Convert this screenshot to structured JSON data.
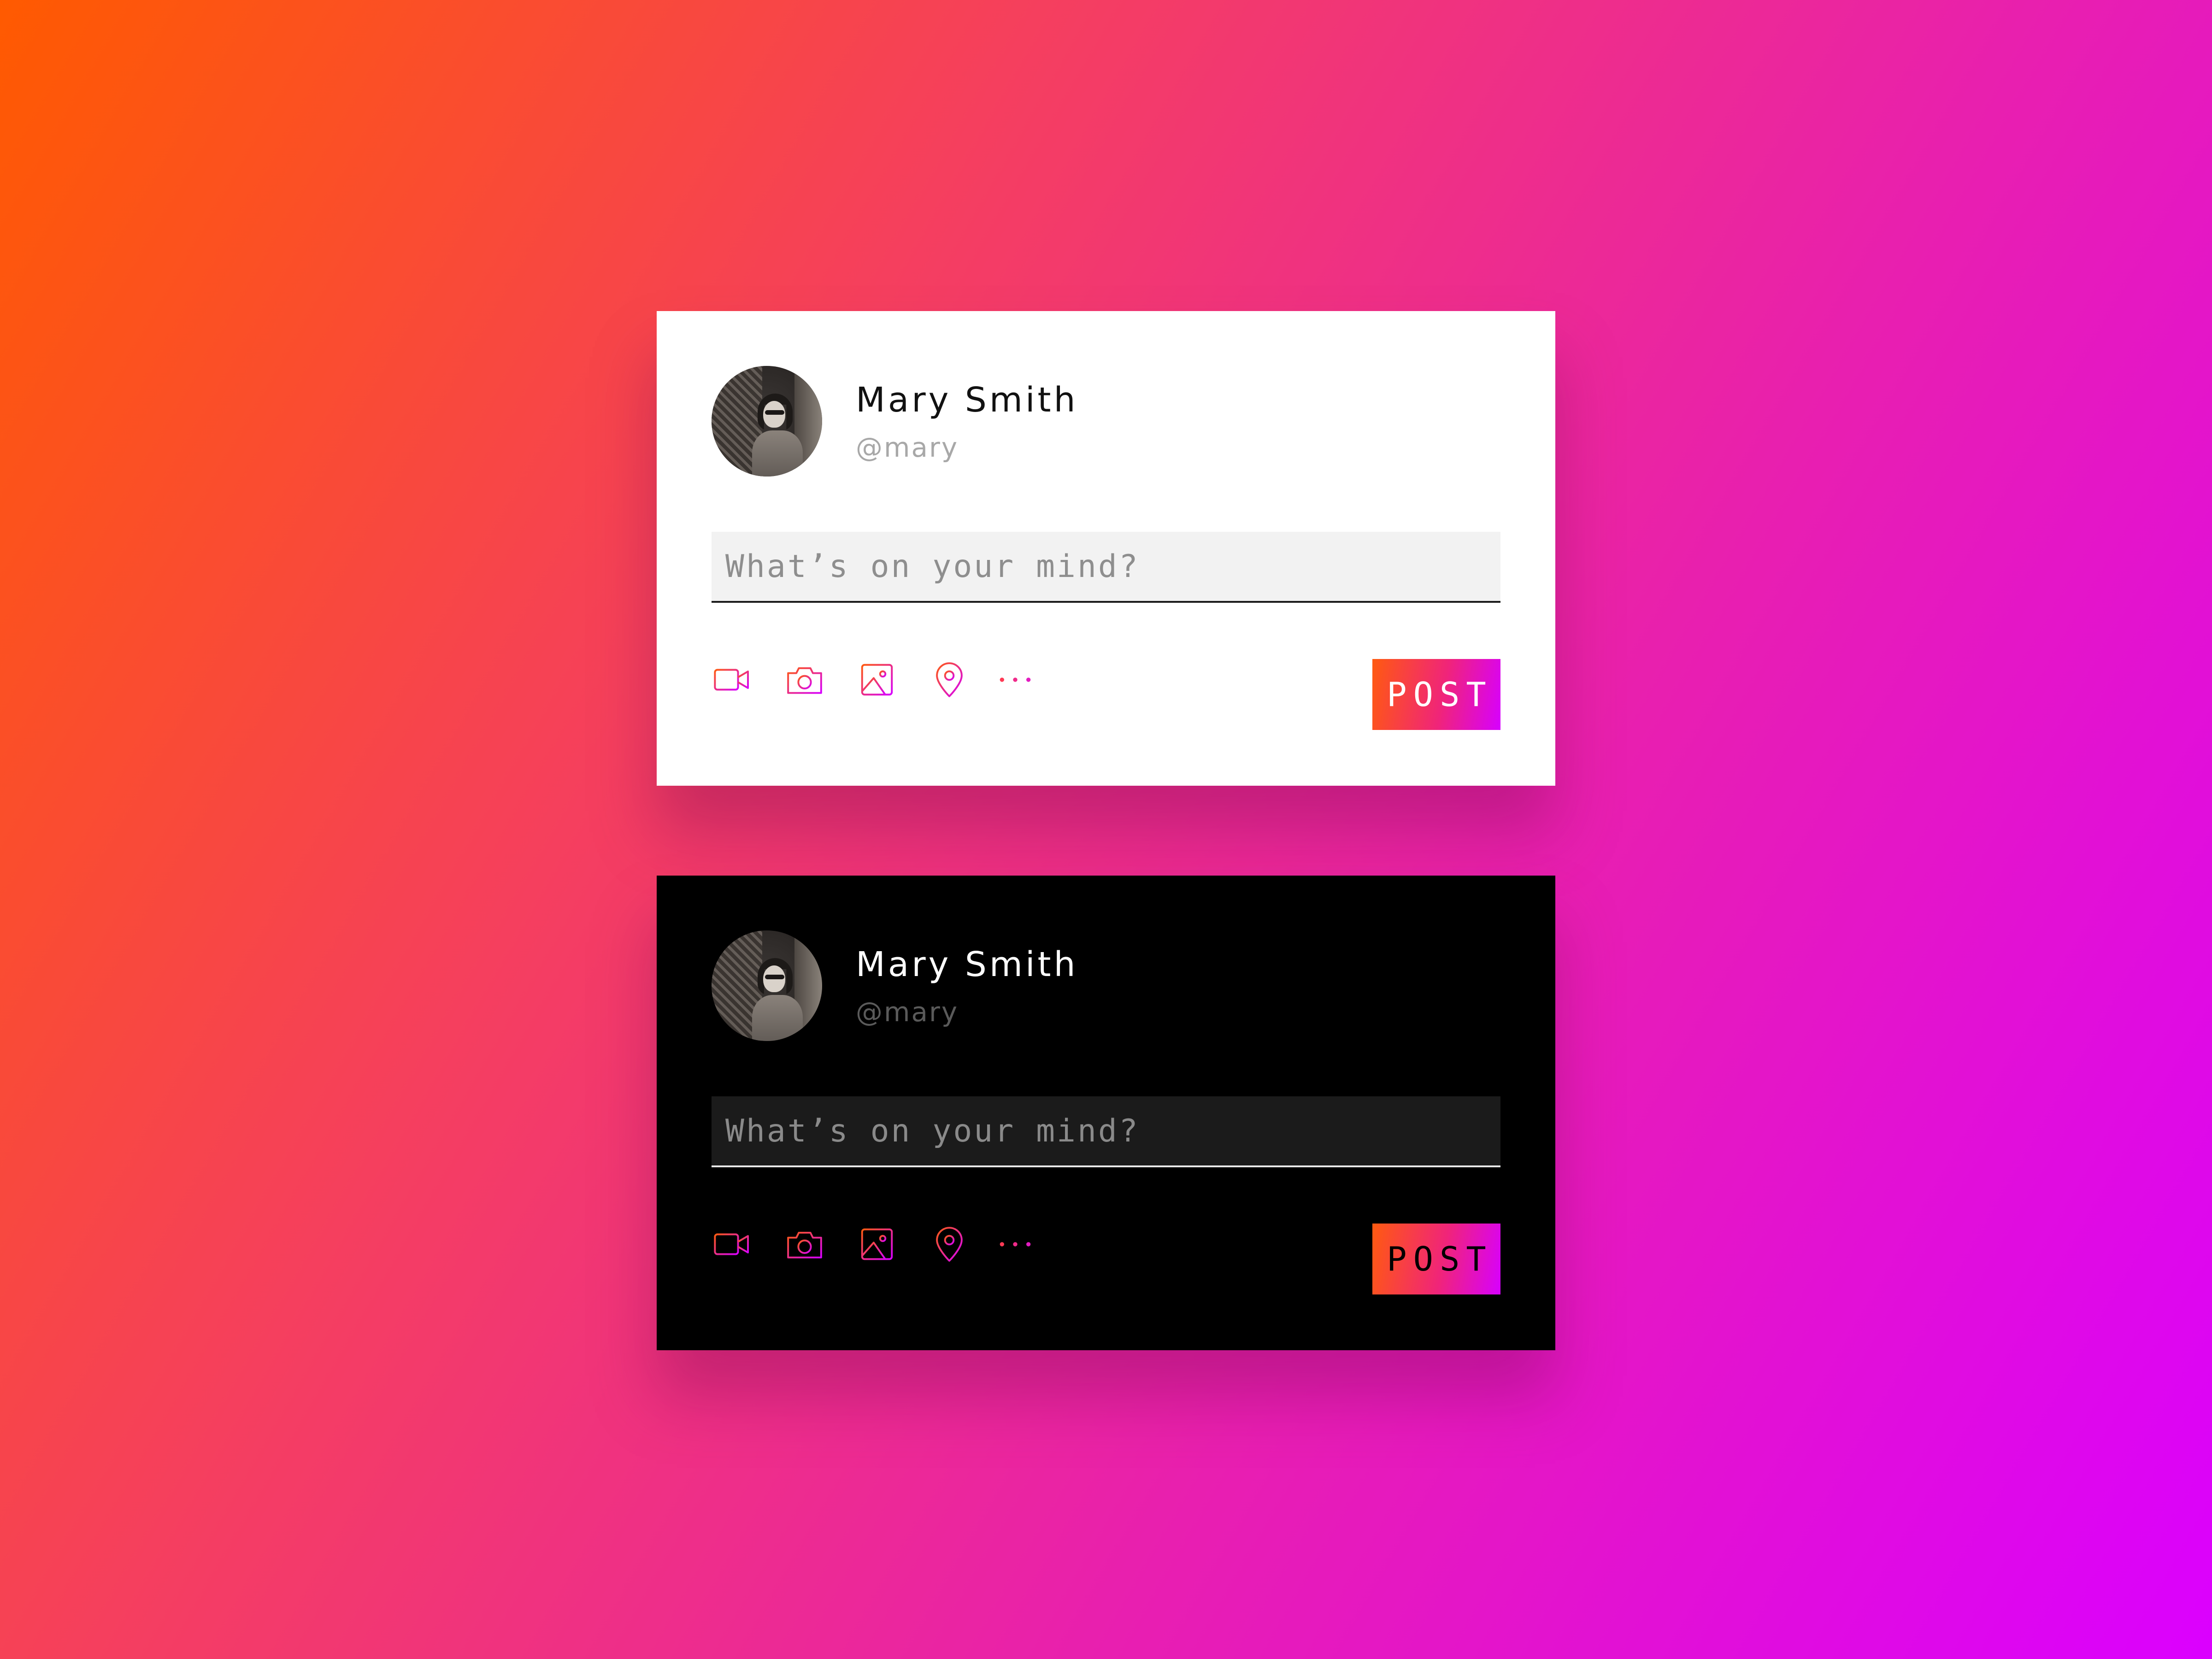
{
  "colors": {
    "icon_gradient_start": "#ff5a10",
    "icon_gradient_end": "#d700ff",
    "light_card_bg": "#ffffff",
    "dark_card_bg": "#000000"
  },
  "cards": [
    {
      "theme": "light",
      "user": {
        "name": "Mary Smith",
        "handle": "@mary"
      },
      "composer": {
        "placeholder": "What’s on your mind?",
        "value": ""
      },
      "toolbar": {
        "icons": [
          "video-icon",
          "camera-icon",
          "image-icon",
          "location-pin-icon",
          "more-icon"
        ]
      },
      "post_label": "POST"
    },
    {
      "theme": "dark",
      "user": {
        "name": "Mary Smith",
        "handle": "@mary"
      },
      "composer": {
        "placeholder": "What’s on your mind?",
        "value": ""
      },
      "toolbar": {
        "icons": [
          "video-icon",
          "camera-icon",
          "image-icon",
          "location-pin-icon",
          "more-icon"
        ]
      },
      "post_label": "POST"
    }
  ]
}
